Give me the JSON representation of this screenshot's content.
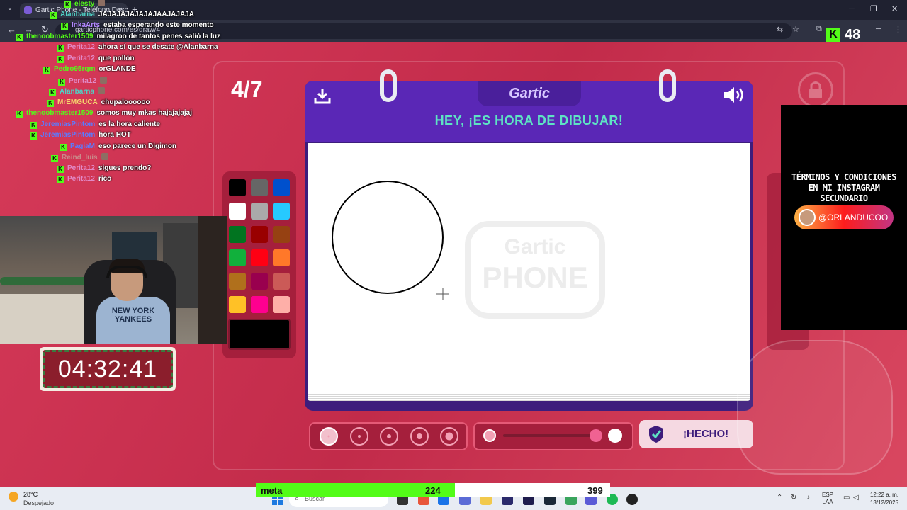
{
  "browser": {
    "tab_title": "Gartic Phone - Teléfono Descomp...",
    "url": "garticphone.com/es/draw/4",
    "new_tab": "+",
    "close_tab": "✕"
  },
  "kick": {
    "badge": "K",
    "viewer_count": "48"
  },
  "chat": [
    {
      "user": "elesty",
      "color": "#53fc18",
      "msg": "",
      "emote": true
    },
    {
      "user": "Alanbarna",
      "color": "#4fd1c5",
      "msg": "JAJAJAJAJAJAJAAJAJAJA"
    },
    {
      "user": "InkaArts",
      "color": "#b388ff",
      "msg": "estaba esperando este momento"
    },
    {
      "user": "thenoobmaster1509",
      "color": "#53fc18",
      "msg": "milagroo de tantos penes salió la luz"
    },
    {
      "user": "Perita12",
      "color": "#e28ac7",
      "msg": "ahora sí que se desate @Alanbarna"
    },
    {
      "user": "Perita12",
      "color": "#e28ac7",
      "msg": "que pollón"
    },
    {
      "user": "Pedro95rqm",
      "color": "#53fc18",
      "msg": "orGLANDE"
    },
    {
      "user": "Perita12",
      "color": "#e28ac7",
      "msg": "",
      "emote": true
    },
    {
      "user": "Alanbarna",
      "color": "#4fd1c5",
      "msg": "",
      "emote": true
    },
    {
      "user": "MrEMGUCA",
      "color": "#f5d76e",
      "msg": "chupaloooooo"
    },
    {
      "user": "thenoobmaster1509",
      "color": "#53fc18",
      "msg": "somos muy mkas hajajajajaj"
    },
    {
      "user": "JeremiasPintom",
      "color": "#5b7bff",
      "msg": "es la hora caliente"
    },
    {
      "user": "JeremiasPintom",
      "color": "#5b7bff",
      "msg": "hora HOT"
    },
    {
      "user": "PagiaM",
      "color": "#5b7bff",
      "msg": "eso parece un Digimon"
    },
    {
      "user": "Reind_luis",
      "color": "#c98a8a",
      "msg": "",
      "emote": true
    },
    {
      "user": "Perita12",
      "color": "#e28ac7",
      "msg": "sigues prendo?"
    },
    {
      "user": "Perita12",
      "color": "#e28ac7",
      "msg": "rico"
    }
  ],
  "webcam": {
    "shirt_text": "NEW YORK YANKEES"
  },
  "timer": "04:32:41",
  "game": {
    "round": "4/7",
    "logo": "Gartic",
    "headline": "HEY, ¡ES HORA DE DIBUJAR!",
    "done_label": "¡HECHO!",
    "watermark_top": "Gartic",
    "watermark_bottom": "PHONE"
  },
  "palette": [
    "#000000",
    "#666666",
    "#0050cd",
    "#ffffff",
    "#aaaaaa",
    "#26c9ff",
    "#017420",
    "#990000",
    "#964112",
    "#11b03c",
    "#ff0013",
    "#ff7829",
    "#b0701c",
    "#99004e",
    "#cb5a57",
    "#ffc126",
    "#ff008f",
    "#feafa8"
  ],
  "current_color": "#000000",
  "brush_sizes": [
    {
      "name": "size-1",
      "active": true
    },
    {
      "name": "size-2",
      "active": false
    },
    {
      "name": "size-3",
      "active": false
    },
    {
      "name": "size-4",
      "active": false
    },
    {
      "name": "size-5",
      "active": false
    }
  ],
  "promo": {
    "text": "TÉRMINOS Y CONDICIONES EN MI INSTAGRAM SECUNDARIO",
    "handle": "@ORLANDUCOO"
  },
  "goal": {
    "label": "meta",
    "current": "224",
    "target": "399",
    "progress": 0.561
  },
  "taskbar": {
    "temp": "28°C",
    "weather": "Despejado",
    "search_placeholder": "Buscar",
    "lang_line1": "ESP",
    "lang_line2": "LAA",
    "time": "12:22 a. m.",
    "date": "13/12/2025"
  }
}
